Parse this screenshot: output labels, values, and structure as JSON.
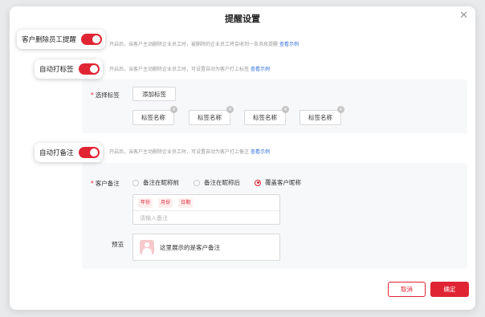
{
  "dialog": {
    "title": "提醒设置",
    "close_icon": "close-icon"
  },
  "settings": [
    {
      "label": "客户删除员工提醒",
      "enabled": true,
      "description": "开启后，当客户主动删除企业员工时，被删除的企业员工将会收到一条消息提醒",
      "link": "查看示例"
    },
    {
      "label": "自动打标签",
      "enabled": true,
      "description": "开启后，当客户主动删除企业员工时，可设置自动为客户打上标签",
      "link": "查看示例"
    },
    {
      "label": "自动打备注",
      "enabled": true,
      "description": "开启后，当客户主动删除企业员工时，可设置自动为客户打上备注",
      "link": "查看示例"
    }
  ],
  "tag_section": {
    "label": "选择标签",
    "add_button": "添加标签",
    "tags": [
      "标签名称",
      "标签名称",
      "标签名称",
      "标签名称"
    ],
    "remove_icon": "close-circle-icon"
  },
  "remark_section": {
    "label": "客户备注",
    "options": [
      "备注在昵称前",
      "备注在昵称后",
      "覆盖客户昵称"
    ],
    "selected_option": "覆盖客户昵称",
    "variables": [
      "年份",
      "月份",
      "日期"
    ],
    "input_placeholder": "请输入备注",
    "preview_label": "预览",
    "preview_text": "这里展示的是客户备注",
    "avatar_icon": "user-avatar-icon"
  },
  "footer": {
    "cancel": "取消",
    "confirm": "确定"
  },
  "colors": {
    "accent": "#e02433",
    "link": "#2f6fd8",
    "section_bg": "#f7f8fa"
  }
}
